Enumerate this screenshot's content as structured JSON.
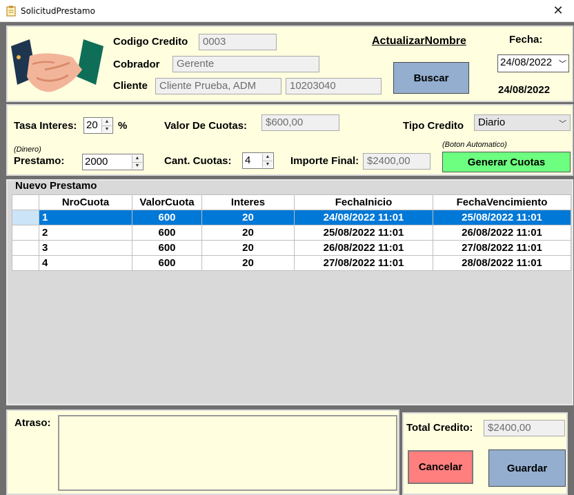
{
  "window": {
    "title": "SolicitudPrestamo"
  },
  "header": {
    "codigo_label": "Codigo Credito",
    "codigo_value": "0003",
    "cobrador_label": "Cobrador",
    "cobrador_value": "Gerente",
    "cliente_label": "Cliente",
    "cliente_name": "Cliente Prueba, ADM",
    "cliente_id": "10203040",
    "actualizar_link": "ActualizarNombre",
    "buscar_button": "Buscar",
    "fecha_label": "Fecha:",
    "fecha_picker": "24/08/2022",
    "fecha_text": "24/08/2022"
  },
  "params": {
    "tasa_label": "Tasa Interes:",
    "tasa_value": "20",
    "tasa_unit": "%",
    "valor_cuotas_label": "Valor De Cuotas:",
    "valor_cuotas_value": "$600,00",
    "tipo_credito_label": "Tipo Credito",
    "tipo_credito_value": "Diario",
    "dinero_note": "(Dinero)",
    "prestamo_label": "Prestamo:",
    "prestamo_value": "2000",
    "cant_cuotas_label": "Cant. Cuotas:",
    "cant_cuotas_value": "4",
    "importe_label": "Importe Final:",
    "importe_value": "$2400,00",
    "boton_note": "(Boton Automatico)",
    "generar_button": "Generar Cuotas"
  },
  "grid": {
    "group_title": "Nuevo Prestamo",
    "columns": [
      "NroCuota",
      "ValorCuota",
      "Interes",
      "FechaInicio",
      "FechaVencimiento"
    ],
    "rows": [
      [
        "1",
        "600",
        "20",
        "24/08/2022 11:01",
        "25/08/2022 11:01"
      ],
      [
        "2",
        "600",
        "20",
        "25/08/2022 11:01",
        "26/08/2022 11:01"
      ],
      [
        "3",
        "600",
        "20",
        "26/08/2022 11:01",
        "27/08/2022 11:01"
      ],
      [
        "4",
        "600",
        "20",
        "27/08/2022 11:01",
        "28/08/2022 11:01"
      ]
    ],
    "selected_row": 0
  },
  "footer": {
    "atraso_label": "Atraso:",
    "total_label": "Total Credito:",
    "total_value": "$2400,00",
    "cancelar_button": "Cancelar",
    "guardar_button": "Guardar"
  },
  "colors": {
    "panel": "#fffedf",
    "buscar": "#93aecf",
    "generar": "#6dff7f",
    "cancelar": "#ff7f7f",
    "guardar": "#93aecf",
    "selection": "#0078d7"
  }
}
